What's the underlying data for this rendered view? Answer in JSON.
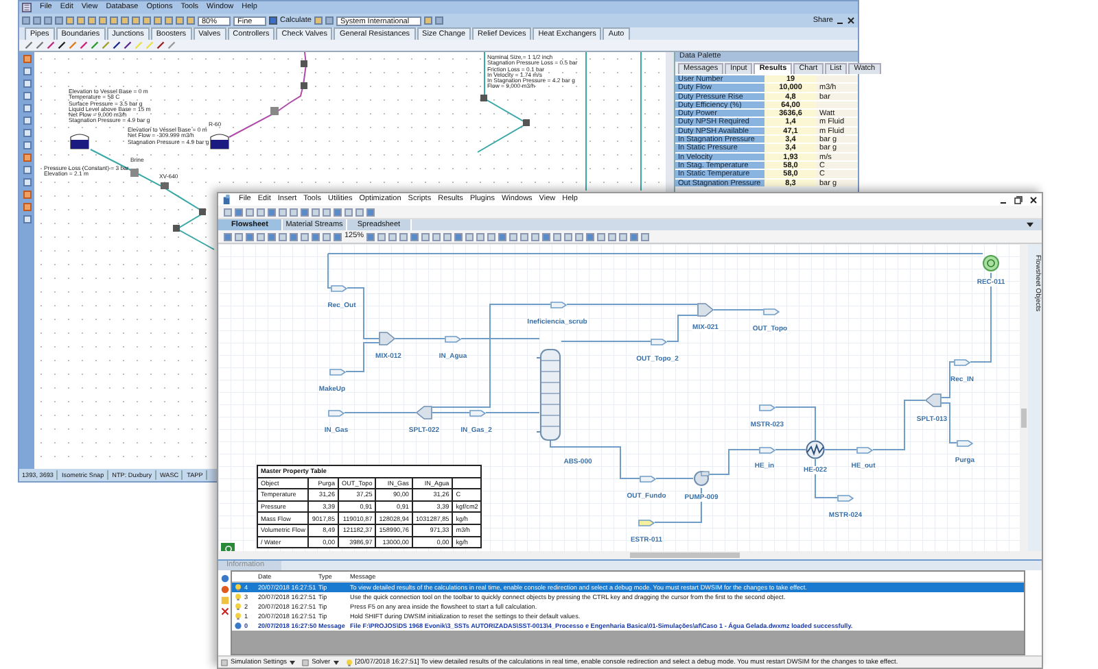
{
  "back_window": {
    "menu": [
      "File",
      "Edit",
      "View",
      "Database",
      "Options",
      "Tools",
      "Window",
      "Help"
    ],
    "toolbar": {
      "zoom": "80%",
      "quality": "Fine",
      "calculate": {
        "label": "Calculate",
        "checked": true
      },
      "units": "System International",
      "share": "Share"
    },
    "tabs": [
      "Pipes",
      "Boundaries",
      "Junctions",
      "Boosters",
      "Valves",
      "Controllers",
      "Check Valves",
      "General Resistances",
      "Size Change",
      "Relief Devices",
      "Heat Exchangers",
      "Auto"
    ],
    "canvas_labels": [
      {
        "lines": [
          "Elevation to Vessel Base = 0 m",
          "Temperature = 58 C",
          "Surface Pressure = 3.5 bar g",
          "Liquid Level above Base = 15 m",
          "Net Flow = 9,000 m3/h",
          "Stagnation Pressure = 4.9 bar g"
        ]
      },
      {
        "lines": [
          "Elevation to Vessel Base = 0 m",
          "Net Flow = -309.999 m3/h",
          "Stagnation Pressure = 4.9 bar g"
        ]
      },
      {
        "lines": [
          "R-60"
        ]
      },
      {
        "lines": [
          "Pressure Loss (Constant) = 3 bar",
          "Elevation = 2.1 m"
        ]
      },
      {
        "lines": [
          "Brine"
        ]
      },
      {
        "lines": [
          "XV-640"
        ]
      },
      {
        "lines": [
          "Nominal Size = 1 1/2 inch",
          "Stagnation Pressure Loss = 0.5 bar",
          "Friction Loss = 0.1 bar",
          "In Velocity = 1.74 m/s",
          "In Stagnation Pressure = 4.2 bar g",
          "Flow = 9,000 m3/h"
        ]
      }
    ],
    "data_palette": {
      "title": "Data Palette",
      "tabs": [
        {
          "label": "Messages",
          "selected": false
        },
        {
          "label": "Input",
          "selected": false
        },
        {
          "label": "Results",
          "selected": true
        },
        {
          "label": "Chart",
          "selected": false
        },
        {
          "label": "List",
          "selected": false
        },
        {
          "label": "Watch",
          "selected": false
        }
      ],
      "rows": [
        {
          "label": "User Number",
          "value": "19",
          "unit": ""
        },
        {
          "label": "Duty Flow",
          "value": "10,000",
          "unit": "m3/h"
        },
        {
          "label": "Duty Pressure Rise",
          "value": "4,8",
          "unit": "bar"
        },
        {
          "label": "Duty Efficiency (%)",
          "value": "64,00",
          "unit": ""
        },
        {
          "label": "Duty Power",
          "value": "3636,6",
          "unit": "Watt"
        },
        {
          "label": "Duty NPSH Required",
          "value": "1,4",
          "unit": "m Fluid"
        },
        {
          "label": "Duty NPSH Available",
          "value": "47,1",
          "unit": "m Fluid"
        },
        {
          "label": "In Stagnation Pressure",
          "value": "3,4",
          "unit": "bar g"
        },
        {
          "label": "In Static Pressure",
          "value": "3,4",
          "unit": "bar g"
        },
        {
          "label": "In Velocity",
          "value": "1,93",
          "unit": "m/s"
        },
        {
          "label": "In Stag. Temperature",
          "value": "58,0",
          "unit": "C"
        },
        {
          "label": "In Static Temperature",
          "value": "58,0",
          "unit": "C"
        },
        {
          "label": "Out Stagnation Pressure",
          "value": "8,3",
          "unit": "bar g"
        }
      ]
    },
    "status_bar": [
      "1393, 3693",
      "Isometric Snap",
      "NTP: Duxbury",
      "WASC",
      "TAPP"
    ]
  },
  "front_window": {
    "menu": [
      "File",
      "Edit",
      "Insert",
      "Tools",
      "Utilities",
      "Optimization",
      "Scripts",
      "Results",
      "Plugins",
      "Windows",
      "View",
      "Help"
    ],
    "tabs": [
      {
        "label": "Flowsheet",
        "selected": true
      },
      {
        "label": "Material Streams",
        "selected": false
      },
      {
        "label": "Spreadsheet",
        "selected": false
      }
    ],
    "zoom": "125%",
    "side_tab": "Flowsheet Objects",
    "nodes": [
      {
        "kind": "stream",
        "label": "Rec_Out"
      },
      {
        "kind": "mixer",
        "label": "MIX-012"
      },
      {
        "kind": "stream",
        "label": "IN_Agua"
      },
      {
        "kind": "stream",
        "label": "MakeUp"
      },
      {
        "kind": "stream",
        "label": "IN_Gas"
      },
      {
        "kind": "splitter",
        "label": "SPLT-022"
      },
      {
        "kind": "stream",
        "label": "IN_Gas_2"
      },
      {
        "kind": "stream",
        "label": "Ineficiencia_scrub"
      },
      {
        "kind": "mixer",
        "label": "MIX-021"
      },
      {
        "kind": "stream",
        "label": "OUT_Topo"
      },
      {
        "kind": "stream",
        "label": "OUT_Topo_2"
      },
      {
        "kind": "column",
        "label": "ABS-000"
      },
      {
        "kind": "stream",
        "label": "OUT_Fundo"
      },
      {
        "kind": "pump",
        "label": "PUMP-009"
      },
      {
        "kind": "energy",
        "label": "ESTR-011"
      },
      {
        "kind": "stream",
        "label": "MSTR-023"
      },
      {
        "kind": "stream",
        "label": "HE_in"
      },
      {
        "kind": "heater",
        "label": "HE-022"
      },
      {
        "kind": "stream",
        "label": "HE_out"
      },
      {
        "kind": "stream",
        "label": "MSTR-024"
      },
      {
        "kind": "splitter",
        "label": "SPLT-013"
      },
      {
        "kind": "stream",
        "label": "Rec_IN"
      },
      {
        "kind": "stream",
        "label": "Purga"
      },
      {
        "kind": "recycle",
        "label": "REC-011"
      }
    ],
    "property_table": {
      "title": "Master Property Table",
      "columns": [
        "Object",
        "Purga",
        "OUT_Topo",
        "IN_Gas",
        "IN_Agua"
      ],
      "rows": [
        [
          "Temperature",
          "31,26",
          "37,25",
          "90,00",
          "31,26",
          "C"
        ],
        [
          "Pressure",
          "3,39",
          "0,91",
          "0,91",
          "3,39",
          "kgf/cm2"
        ],
        [
          "Mass Flow",
          "9017,85",
          "119010,87",
          "128028,94",
          "1031287,85",
          "kg/h"
        ],
        [
          "Volumetric Flow",
          "8,49",
          "121182,37",
          "158990,76",
          "971,33",
          "m3/h"
        ],
        [
          "/ Water",
          "0,00",
          "3986,97",
          "13000,00",
          "0,00",
          "kg/h"
        ]
      ]
    },
    "log": {
      "tab": "Information",
      "columns": [
        "Date",
        "Type",
        "Message"
      ],
      "rows": [
        {
          "kind": "tip",
          "number": "4",
          "date": "20/07/2018 16:27:51",
          "type": "Tip",
          "message": "To view detailed results of the calculations in real time, enable console redirection and select a debug mode. You must restart DWSIM for the changes to take effect.",
          "selected": true
        },
        {
          "kind": "tip",
          "number": "3",
          "date": "20/07/2018 16:27:51",
          "type": "Tip",
          "message": "Use the quick connection tool on the toolbar to quickly connect objects by pressing the CTRL key and dragging the cursor from the first to the second object.",
          "selected": false
        },
        {
          "kind": "tip",
          "number": "2",
          "date": "20/07/2018 16:27:51",
          "type": "Tip",
          "message": "Press F5 on any area inside the flowsheet to start a full calculation.",
          "selected": false
        },
        {
          "kind": "tip",
          "number": "1",
          "date": "20/07/2018 16:27:51",
          "type": "Tip",
          "message": "Hold SHIFT during DWSIM initialization to reset the settings to their default values.",
          "selected": false
        },
        {
          "kind": "message",
          "number": "0",
          "date": "20/07/2018 16:27:50",
          "type": "Message",
          "message": "File F:\\PROJOS\\DS 1968 Evonik\\3_SSTs AUTORIZADAS\\SST-0013\\4_Processo e Engenharia Basica\\01-Simulações\\af\\Caso 1 - Água Gelada.dwxmz loaded successfully.",
          "selected": false
        }
      ]
    },
    "status_bar": {
      "items": [
        "Simulation Settings",
        "Solver"
      ],
      "message": "[20/07/2018 16:27:51] To view detailed results of the calculations in real time, enable console redirection and select a debug mode. You must restart DWSIM for the changes to take effect."
    }
  }
}
